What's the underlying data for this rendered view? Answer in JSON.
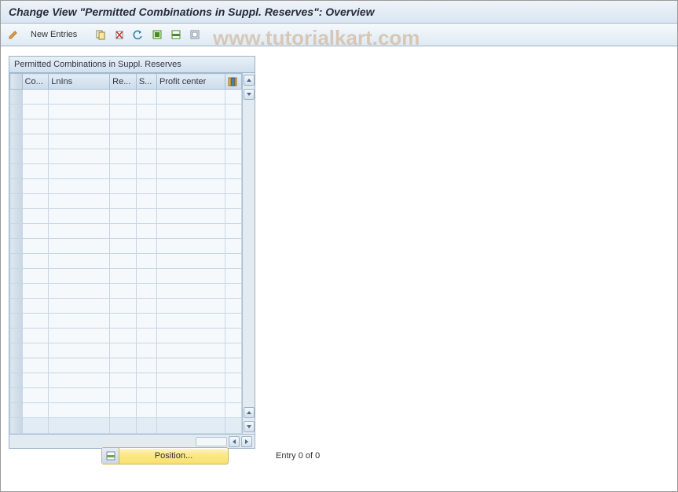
{
  "title": "Change View \"Permitted Combinations in Suppl. Reserves\": Overview",
  "watermark": "www.tutorialkart.com",
  "toolbar": {
    "new_entries_label": "New Entries"
  },
  "grid": {
    "title": "Permitted Combinations in Suppl. Reserves",
    "columns": {
      "c0": "Co...",
      "c1": "LnIns",
      "c2": "Re...",
      "c3": "S...",
      "c4": "Profit center"
    },
    "row_count": 22
  },
  "footer": {
    "position_label": "Position...",
    "entry_text": "Entry 0 of 0"
  }
}
